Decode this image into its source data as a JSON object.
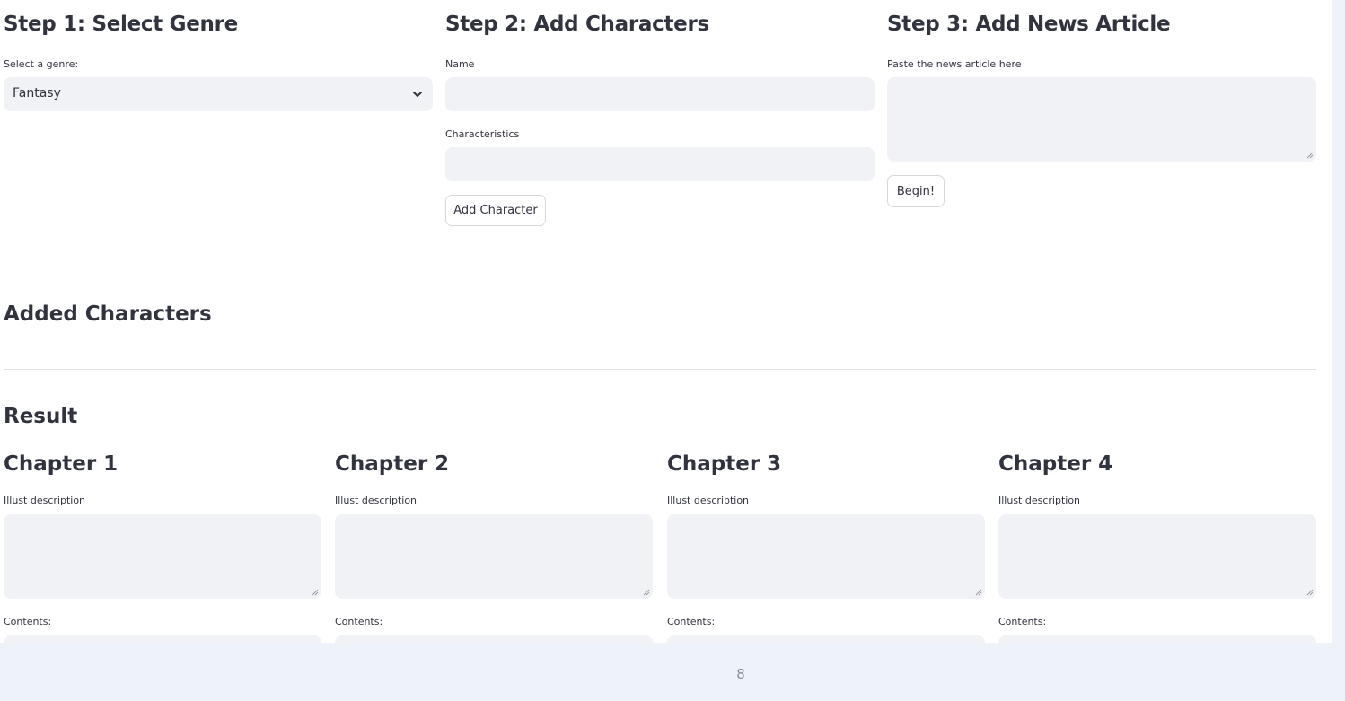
{
  "step1": {
    "title": "Step 1: Select Genre",
    "label": "Select a genre:",
    "selected": "Fantasy"
  },
  "step2": {
    "title": "Step 2: Add Characters",
    "name_label": "Name",
    "name_value": "",
    "char_label": "Characteristics",
    "char_value": "",
    "button": "Add Character"
  },
  "step3": {
    "title": "Step 3: Add News Article",
    "label": "Paste the news article here",
    "value": "",
    "button": "Begin!"
  },
  "added": {
    "title": "Added Characters"
  },
  "result": {
    "title": "Result",
    "chapters": [
      {
        "title": "Chapter 1",
        "desc_label": "Illust description",
        "contents_label": "Contents:"
      },
      {
        "title": "Chapter 2",
        "desc_label": "Illust description",
        "contents_label": "Contents:"
      },
      {
        "title": "Chapter 3",
        "desc_label": "Illust description",
        "contents_label": "Contents:"
      },
      {
        "title": "Chapter 4",
        "desc_label": "Illust description",
        "contents_label": "Contents:"
      }
    ]
  },
  "page_number": "8"
}
